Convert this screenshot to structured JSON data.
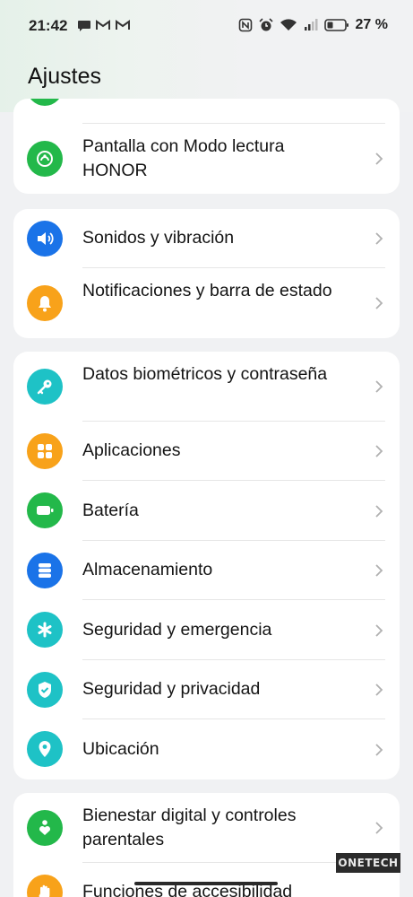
{
  "status_bar": {
    "time": "21:42",
    "battery": "27 %"
  },
  "header": {
    "title": "Ajustes"
  },
  "colors": {
    "green": "#23b84a",
    "blue": "#1a73e8",
    "orange": "#f8a21a",
    "teal": "#1ec2c6",
    "accent_bg": "#e5f1e9"
  },
  "groups": [
    {
      "items": [
        {
          "label": "Pantalla con Modo lectura HONOR",
          "icon": "display-icon"
        }
      ]
    },
    {
      "items": [
        {
          "label": "Sonidos y vibración",
          "icon": "speaker-icon"
        },
        {
          "label": "Notificaciones y barra de estado",
          "icon": "bell-icon"
        }
      ]
    },
    {
      "items": [
        {
          "label": "Datos biométricos y contraseña",
          "icon": "key-icon"
        },
        {
          "label": "Aplicaciones",
          "icon": "apps-icon"
        },
        {
          "label": "Batería",
          "icon": "battery-icon"
        },
        {
          "label": "Almacenamiento",
          "icon": "storage-icon"
        },
        {
          "label": "Seguridad y emergencia",
          "icon": "asterisk-icon"
        },
        {
          "label": "Seguridad y privacidad",
          "icon": "shield-icon"
        },
        {
          "label": "Ubicación",
          "icon": "location-icon"
        }
      ]
    },
    {
      "items": [
        {
          "label": "Bienestar digital y controles parentales",
          "icon": "wellbeing-icon"
        },
        {
          "label": "Funciones de accesibilidad",
          "icon": "hand-icon"
        }
      ]
    }
  ],
  "watermark": "ONETECH"
}
